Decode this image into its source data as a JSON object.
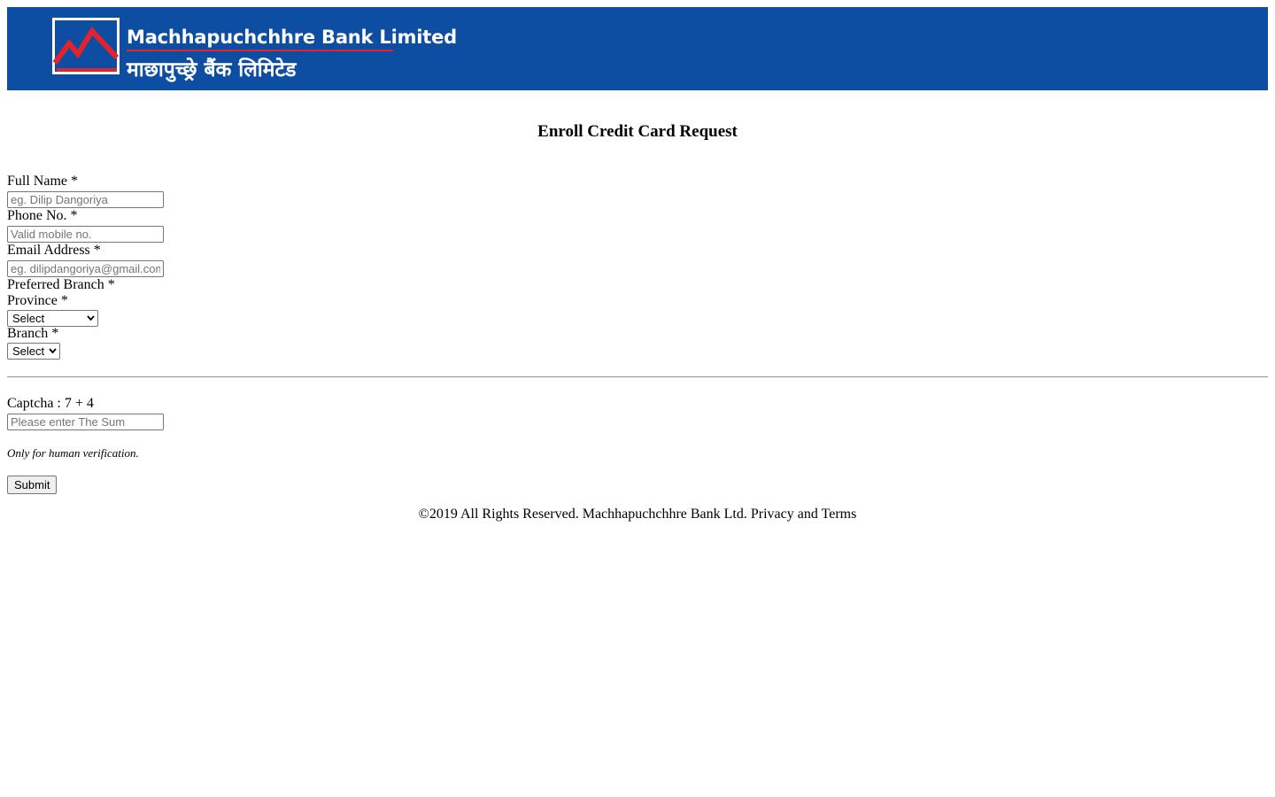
{
  "brand": {
    "name_en": "Machhapuchchhre Bank Limited",
    "name_ne": "माछापुच्छ्रे बैंक लिमिटेड",
    "header_color": "#0d4ea2",
    "accent_color": "#e3232c",
    "logo_icon": "mountain-logo-icon"
  },
  "page": {
    "title": "Enroll Credit Card Request"
  },
  "form": {
    "full_name": {
      "label": "Full Name *",
      "placeholder": "eg. Dilip Dangoriya",
      "value": ""
    },
    "phone": {
      "label": "Phone No. *",
      "placeholder": "Valid mobile no.",
      "value": ""
    },
    "email": {
      "label": "Email Address *",
      "placeholder": "eg. dilipdangoriya@gmail.com",
      "value": ""
    },
    "preferred_branch": {
      "label": "Preferred Branch *"
    },
    "province": {
      "label": "Province *",
      "selected": "Select"
    },
    "branch": {
      "label": "Branch *",
      "selected": "Select"
    },
    "captcha": {
      "label": "Captcha : 7 + 4",
      "placeholder": "Please enter The Sum",
      "value": "",
      "note": "Only for human verification."
    },
    "submit_label": "Submit"
  },
  "footer": {
    "copyright": "©2019 All Rights Reserved. Machhapuchchhre Bank Ltd.",
    "privacy_link": "Privacy and Terms"
  }
}
